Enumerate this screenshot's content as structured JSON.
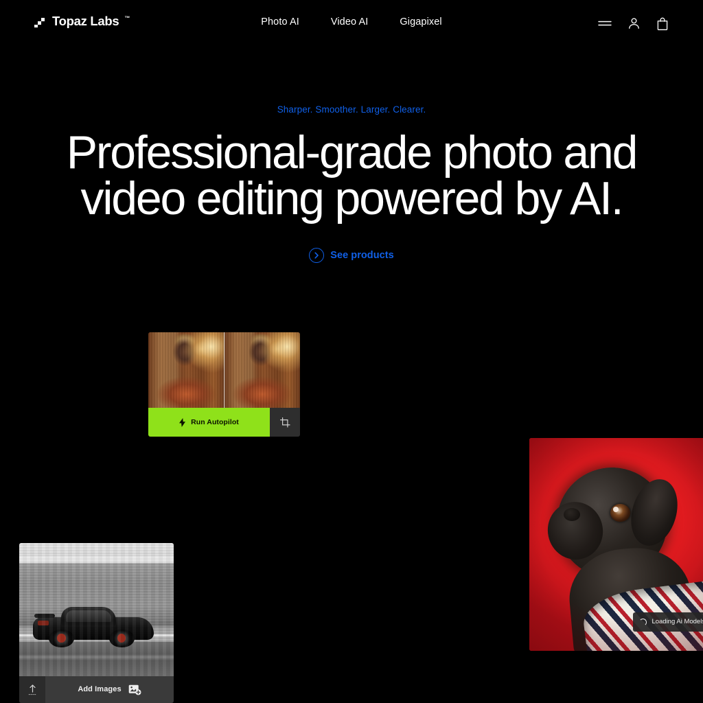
{
  "theme": {
    "background": "#000000",
    "accent_blue": "#1060E8",
    "accent_green": "#8FE11A",
    "text_primary": "#ffffff"
  },
  "header": {
    "brand_name": "Topaz Labs",
    "brand_trademark": "™",
    "nav": [
      {
        "label": "Photo AI",
        "name": "nav-photo-ai"
      },
      {
        "label": "Video AI",
        "name": "nav-video-ai"
      },
      {
        "label": "Gigapixel",
        "name": "nav-gigapixel"
      }
    ],
    "actions": [
      {
        "icon": "hamburger-menu-icon"
      },
      {
        "icon": "user-account-icon"
      },
      {
        "icon": "shopping-bag-icon"
      }
    ]
  },
  "hero": {
    "eyebrow": "Sharper. Smoother. Larger. Clearer.",
    "title_line1": "Professional-grade photo and",
    "title_line2": "video editing powered by AI.",
    "cta_label": "See products",
    "cta_icon": "chevron-right-circle-icon"
  },
  "cards": {
    "autopilot": {
      "name": "autopilot-preview-card",
      "subject": "portrait before-after comparison",
      "run_label": "Run Autopilot",
      "run_icon": "lightning-bolt-icon",
      "crop_icon": "crop-tool-icon"
    },
    "pug": {
      "name": "pug-preview-card",
      "subject": "black pug on red background",
      "toast_label": "Loading Ai Models...",
      "toast_icon": "loading-spinner-icon"
    },
    "car": {
      "name": "car-preview-card",
      "subject": "black sports car motion blur",
      "add_label": "Add Images",
      "add_icon": "add-image-icon",
      "export_icon": "export-upload-icon"
    }
  }
}
